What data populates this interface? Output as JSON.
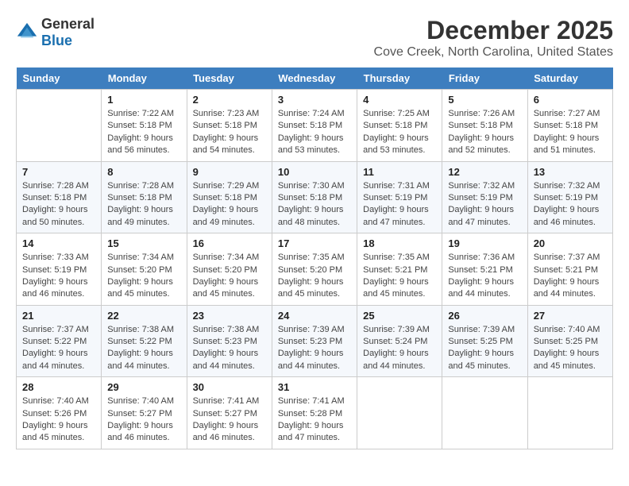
{
  "logo": {
    "text1": "General",
    "text2": "Blue"
  },
  "title": "December 2025",
  "subtitle": "Cove Creek, North Carolina, United States",
  "weekdays": [
    "Sunday",
    "Monday",
    "Tuesday",
    "Wednesday",
    "Thursday",
    "Friday",
    "Saturday"
  ],
  "weeks": [
    [
      {
        "day": "",
        "sunrise": "",
        "sunset": "",
        "daylight": ""
      },
      {
        "day": "1",
        "sunrise": "Sunrise: 7:22 AM",
        "sunset": "Sunset: 5:18 PM",
        "daylight": "Daylight: 9 hours and 56 minutes."
      },
      {
        "day": "2",
        "sunrise": "Sunrise: 7:23 AM",
        "sunset": "Sunset: 5:18 PM",
        "daylight": "Daylight: 9 hours and 54 minutes."
      },
      {
        "day": "3",
        "sunrise": "Sunrise: 7:24 AM",
        "sunset": "Sunset: 5:18 PM",
        "daylight": "Daylight: 9 hours and 53 minutes."
      },
      {
        "day": "4",
        "sunrise": "Sunrise: 7:25 AM",
        "sunset": "Sunset: 5:18 PM",
        "daylight": "Daylight: 9 hours and 53 minutes."
      },
      {
        "day": "5",
        "sunrise": "Sunrise: 7:26 AM",
        "sunset": "Sunset: 5:18 PM",
        "daylight": "Daylight: 9 hours and 52 minutes."
      },
      {
        "day": "6",
        "sunrise": "Sunrise: 7:27 AM",
        "sunset": "Sunset: 5:18 PM",
        "daylight": "Daylight: 9 hours and 51 minutes."
      }
    ],
    [
      {
        "day": "7",
        "sunrise": "Sunrise: 7:28 AM",
        "sunset": "Sunset: 5:18 PM",
        "daylight": "Daylight: 9 hours and 50 minutes."
      },
      {
        "day": "8",
        "sunrise": "Sunrise: 7:28 AM",
        "sunset": "Sunset: 5:18 PM",
        "daylight": "Daylight: 9 hours and 49 minutes."
      },
      {
        "day": "9",
        "sunrise": "Sunrise: 7:29 AM",
        "sunset": "Sunset: 5:18 PM",
        "daylight": "Daylight: 9 hours and 49 minutes."
      },
      {
        "day": "10",
        "sunrise": "Sunrise: 7:30 AM",
        "sunset": "Sunset: 5:18 PM",
        "daylight": "Daylight: 9 hours and 48 minutes."
      },
      {
        "day": "11",
        "sunrise": "Sunrise: 7:31 AM",
        "sunset": "Sunset: 5:19 PM",
        "daylight": "Daylight: 9 hours and 47 minutes."
      },
      {
        "day": "12",
        "sunrise": "Sunrise: 7:32 AM",
        "sunset": "Sunset: 5:19 PM",
        "daylight": "Daylight: 9 hours and 47 minutes."
      },
      {
        "day": "13",
        "sunrise": "Sunrise: 7:32 AM",
        "sunset": "Sunset: 5:19 PM",
        "daylight": "Daylight: 9 hours and 46 minutes."
      }
    ],
    [
      {
        "day": "14",
        "sunrise": "Sunrise: 7:33 AM",
        "sunset": "Sunset: 5:19 PM",
        "daylight": "Daylight: 9 hours and 46 minutes."
      },
      {
        "day": "15",
        "sunrise": "Sunrise: 7:34 AM",
        "sunset": "Sunset: 5:20 PM",
        "daylight": "Daylight: 9 hours and 45 minutes."
      },
      {
        "day": "16",
        "sunrise": "Sunrise: 7:34 AM",
        "sunset": "Sunset: 5:20 PM",
        "daylight": "Daylight: 9 hours and 45 minutes."
      },
      {
        "day": "17",
        "sunrise": "Sunrise: 7:35 AM",
        "sunset": "Sunset: 5:20 PM",
        "daylight": "Daylight: 9 hours and 45 minutes."
      },
      {
        "day": "18",
        "sunrise": "Sunrise: 7:35 AM",
        "sunset": "Sunset: 5:21 PM",
        "daylight": "Daylight: 9 hours and 45 minutes."
      },
      {
        "day": "19",
        "sunrise": "Sunrise: 7:36 AM",
        "sunset": "Sunset: 5:21 PM",
        "daylight": "Daylight: 9 hours and 44 minutes."
      },
      {
        "day": "20",
        "sunrise": "Sunrise: 7:37 AM",
        "sunset": "Sunset: 5:21 PM",
        "daylight": "Daylight: 9 hours and 44 minutes."
      }
    ],
    [
      {
        "day": "21",
        "sunrise": "Sunrise: 7:37 AM",
        "sunset": "Sunset: 5:22 PM",
        "daylight": "Daylight: 9 hours and 44 minutes."
      },
      {
        "day": "22",
        "sunrise": "Sunrise: 7:38 AM",
        "sunset": "Sunset: 5:22 PM",
        "daylight": "Daylight: 9 hours and 44 minutes."
      },
      {
        "day": "23",
        "sunrise": "Sunrise: 7:38 AM",
        "sunset": "Sunset: 5:23 PM",
        "daylight": "Daylight: 9 hours and 44 minutes."
      },
      {
        "day": "24",
        "sunrise": "Sunrise: 7:39 AM",
        "sunset": "Sunset: 5:23 PM",
        "daylight": "Daylight: 9 hours and 44 minutes."
      },
      {
        "day": "25",
        "sunrise": "Sunrise: 7:39 AM",
        "sunset": "Sunset: 5:24 PM",
        "daylight": "Daylight: 9 hours and 44 minutes."
      },
      {
        "day": "26",
        "sunrise": "Sunrise: 7:39 AM",
        "sunset": "Sunset: 5:25 PM",
        "daylight": "Daylight: 9 hours and 45 minutes."
      },
      {
        "day": "27",
        "sunrise": "Sunrise: 7:40 AM",
        "sunset": "Sunset: 5:25 PM",
        "daylight": "Daylight: 9 hours and 45 minutes."
      }
    ],
    [
      {
        "day": "28",
        "sunrise": "Sunrise: 7:40 AM",
        "sunset": "Sunset: 5:26 PM",
        "daylight": "Daylight: 9 hours and 45 minutes."
      },
      {
        "day": "29",
        "sunrise": "Sunrise: 7:40 AM",
        "sunset": "Sunset: 5:27 PM",
        "daylight": "Daylight: 9 hours and 46 minutes."
      },
      {
        "day": "30",
        "sunrise": "Sunrise: 7:41 AM",
        "sunset": "Sunset: 5:27 PM",
        "daylight": "Daylight: 9 hours and 46 minutes."
      },
      {
        "day": "31",
        "sunrise": "Sunrise: 7:41 AM",
        "sunset": "Sunset: 5:28 PM",
        "daylight": "Daylight: 9 hours and 47 minutes."
      },
      {
        "day": "",
        "sunrise": "",
        "sunset": "",
        "daylight": ""
      },
      {
        "day": "",
        "sunrise": "",
        "sunset": "",
        "daylight": ""
      },
      {
        "day": "",
        "sunrise": "",
        "sunset": "",
        "daylight": ""
      }
    ]
  ]
}
